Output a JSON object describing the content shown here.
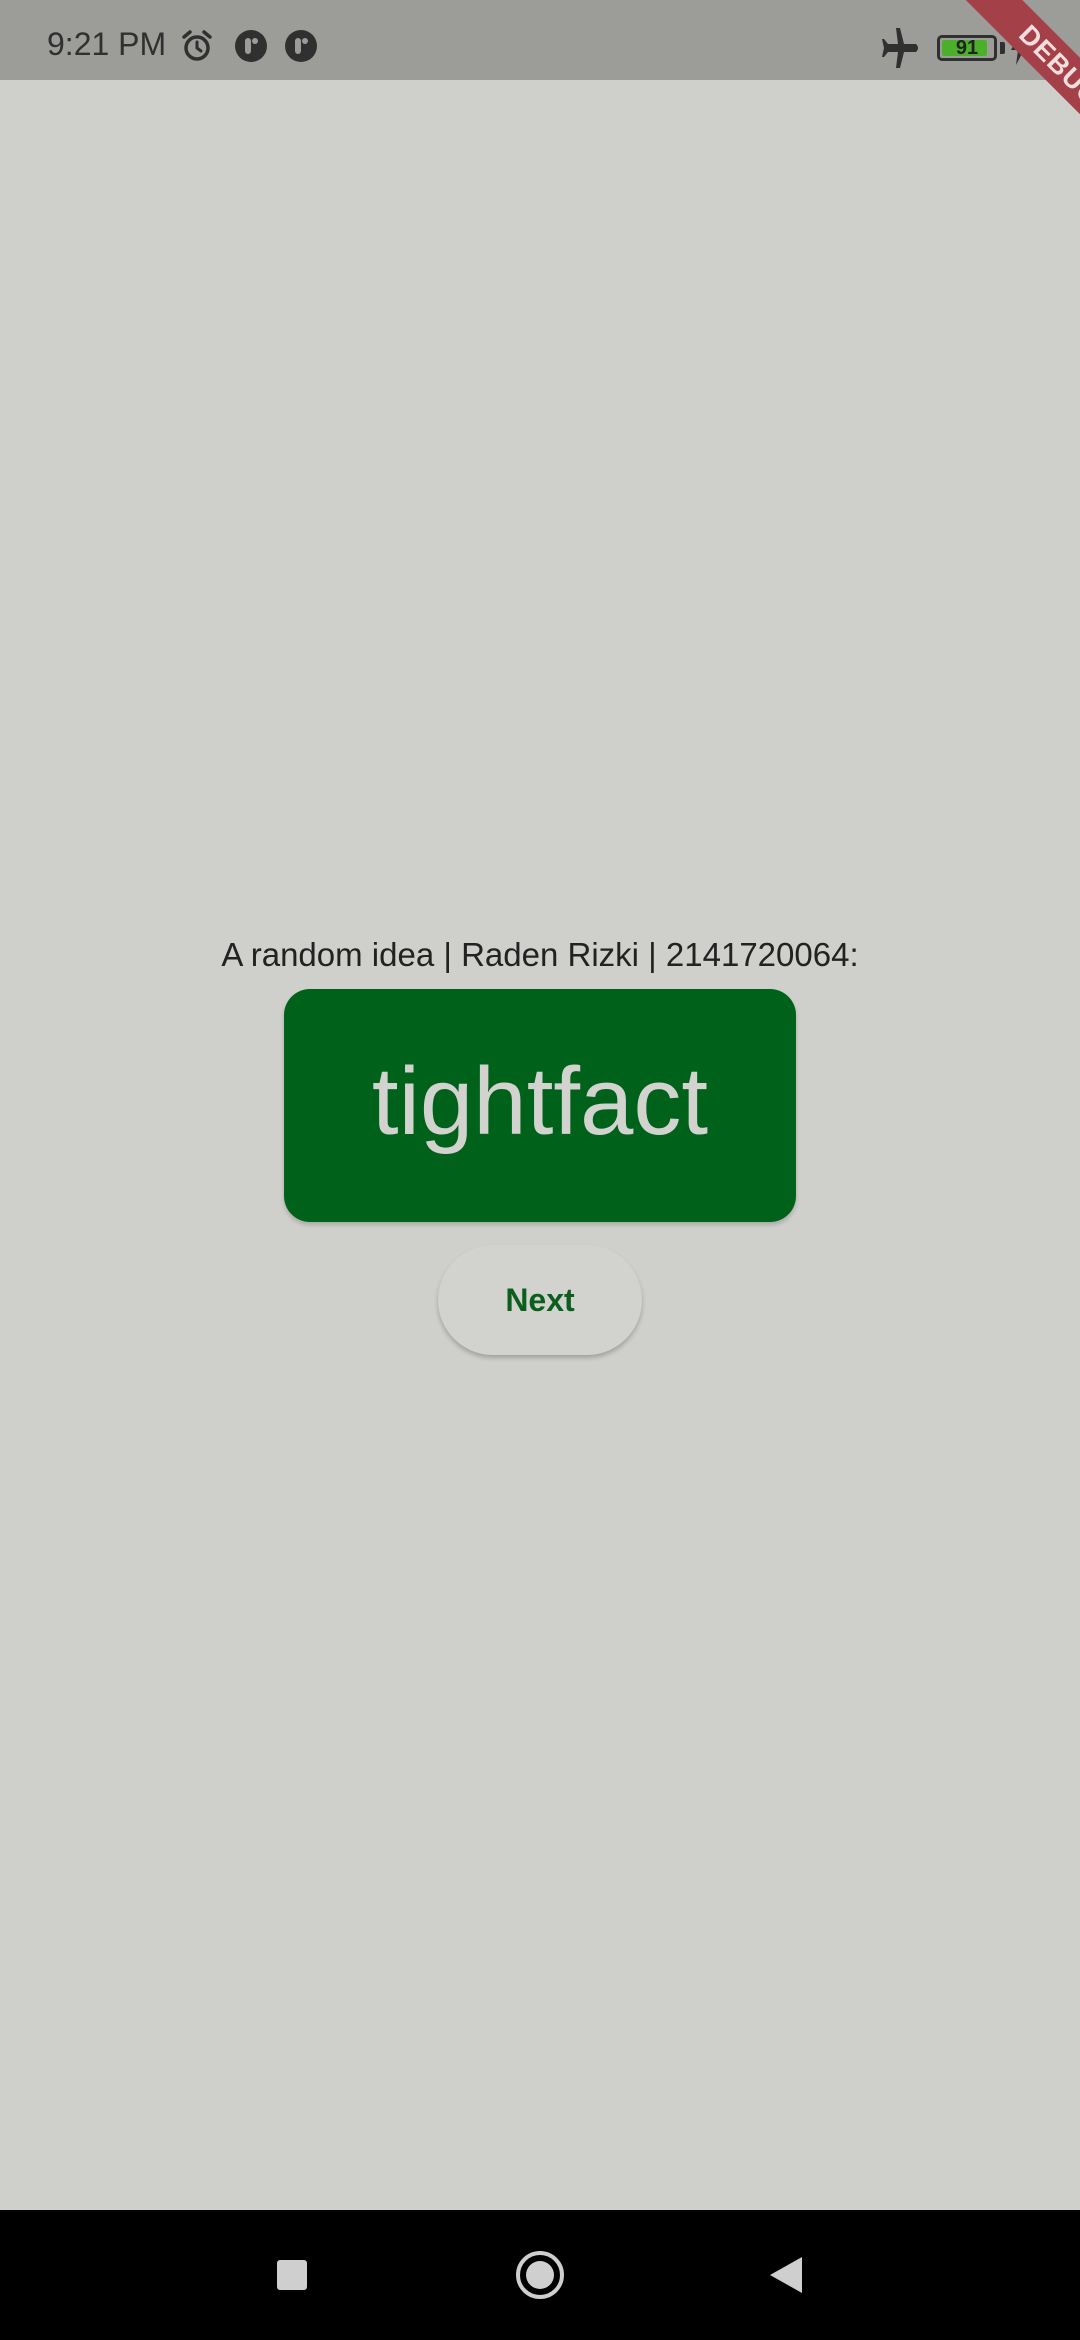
{
  "status_bar": {
    "time": "9:21 PM",
    "icons": [
      "alarm-icon",
      "notification-app-icon",
      "notification-app-icon",
      "airplane-icon",
      "battery-icon",
      "charging-icon"
    ],
    "battery_level": "91",
    "battery_fraction": 0.91,
    "battery_color": "#4caf2a"
  },
  "debug_banner": {
    "label": "DEBUG",
    "color": "#a44048"
  },
  "main": {
    "prompt": "A random idea | Raden Rizki | 2141720064:",
    "idea_word": "tightfact",
    "next_label": "Next",
    "card_color": "#00621a",
    "background_color": "#cfd0cb"
  },
  "nav_bar": {
    "icons": [
      "recents-icon",
      "home-icon",
      "back-icon"
    ]
  }
}
